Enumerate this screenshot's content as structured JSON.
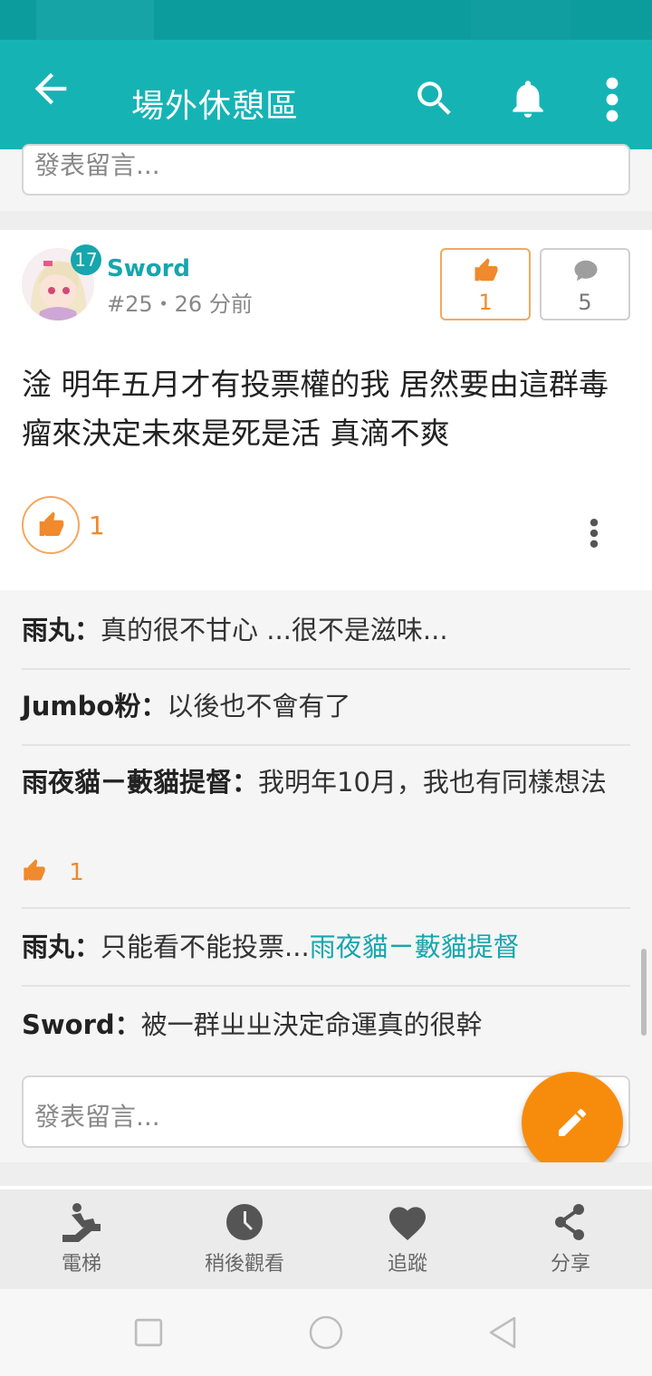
{
  "appbar": {
    "title": "場外休憩區"
  },
  "top_comment": {
    "placeholder": "發表留言..."
  },
  "post": {
    "level": "17",
    "author": "Sword",
    "meta": "#25・26 分前",
    "gp_count": "1",
    "reply_count": "5",
    "content": "淦 明年五月才有投票權的我 居然要由這群毒瘤來決定未來是死是活 真滴不爽",
    "like_count": "1"
  },
  "replies": [
    {
      "author": "雨丸：",
      "text": "真的很不甘心 ...很不是滋味..."
    },
    {
      "author": "Jumbo粉：",
      "text": "以後也不會有了"
    },
    {
      "author": "雨夜貓ㄧ藪貓提督：",
      "text": "我明年10月，我也有同樣想法",
      "gp": "1"
    },
    {
      "author": "雨丸：",
      "text": "只能看不能投票...",
      "link": "雨夜貓ㄧ藪貓提督"
    },
    {
      "author": "Sword：",
      "text": "被一群ㄓㄓ決定命運真的很幹"
    }
  ],
  "bottom_comment": {
    "placeholder": "發表留言..."
  },
  "bottom_nav": [
    {
      "label": "電梯",
      "icon": "escalator-icon"
    },
    {
      "label": "稍後觀看",
      "icon": "clock-icon"
    },
    {
      "label": "追蹤",
      "icon": "heart-icon"
    },
    {
      "label": "分享",
      "icon": "share-icon"
    }
  ],
  "colors": {
    "teal": "#16b3b5",
    "accent": "#16a6ad",
    "orange": "#f78c0c"
  }
}
